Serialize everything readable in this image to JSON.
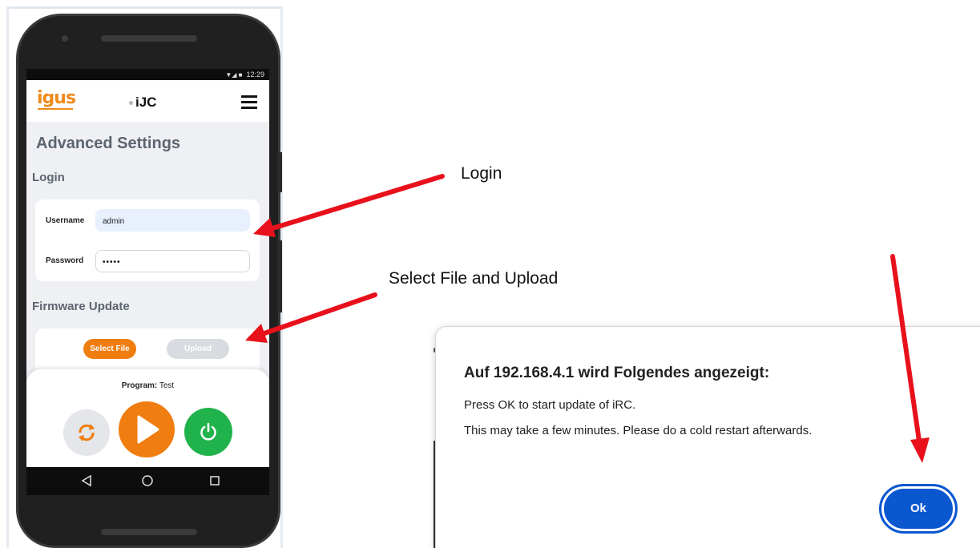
{
  "status_bar": {
    "time": "12:29"
  },
  "app_bar": {
    "logo_brand": "igus",
    "app_name": "iJC"
  },
  "page": {
    "title": "Advanced Settings",
    "login_section": {
      "heading": "Login",
      "username_label": "Username",
      "username_value": "admin",
      "password_label": "Password",
      "password_value": "•••••"
    },
    "firmware_section": {
      "heading": "Firmware Update",
      "select_file_label": "Select File",
      "upload_label": "Upload"
    }
  },
  "bottom_panel": {
    "program_label": "Program:",
    "program_value": "Test",
    "buttons": [
      "sync-icon",
      "play-icon",
      "power-icon"
    ]
  },
  "nav_bar": {
    "icons": [
      "back-icon",
      "home-icon",
      "recents-icon"
    ]
  },
  "annotations": {
    "login": "Login",
    "select_upload": "Select File and Upload"
  },
  "dialog": {
    "title": "Auf 192.168.4.1 wird Folgendes angezeigt:",
    "message_line1": "Press OK to start update of iRC.",
    "message_line2": "This may take a few minutes. Please do a cold restart afterwards.",
    "ok_label": "Ok"
  },
  "colors": {
    "brand_orange": "#ef7d0f",
    "power_green": "#21b34b",
    "dialog_button_blue": "#0b57d0",
    "arrow_red": "#e8111b"
  }
}
